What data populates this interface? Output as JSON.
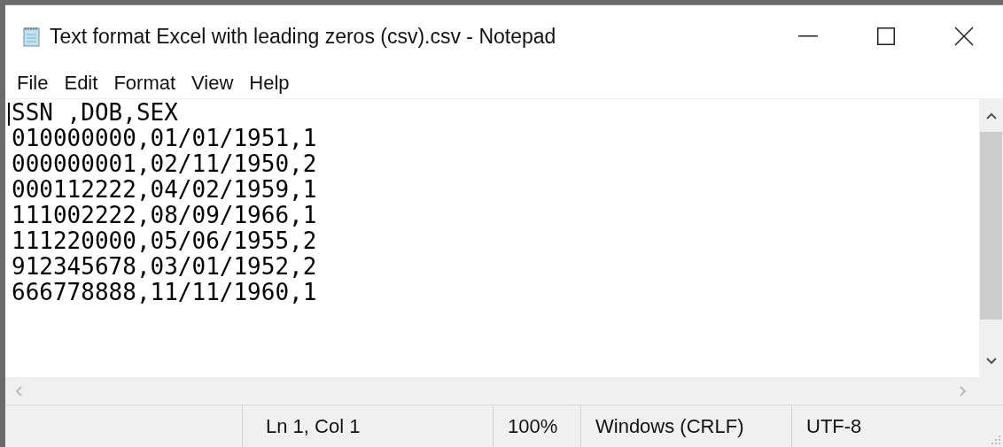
{
  "window": {
    "title": "Text format Excel with leading zeros (csv).csv - Notepad"
  },
  "menu": [
    "File",
    "Edit",
    "Format",
    "View",
    "Help"
  ],
  "editor": {
    "lines": [
      "SSN ,DOB,SEX",
      "010000000,01/01/1951,1",
      "000000001,02/11/1950,2",
      "000112222,04/02/1959,1",
      "111002222,08/09/1966,1",
      "111220000,05/06/1955,2",
      "912345678,03/01/1952,2",
      "666778888,11/11/1960,1"
    ]
  },
  "status_bar": {
    "position": "Ln 1, Col 1",
    "zoom": "100%",
    "line_ending": "Windows (CRLF)",
    "encoding": "UTF-8"
  }
}
